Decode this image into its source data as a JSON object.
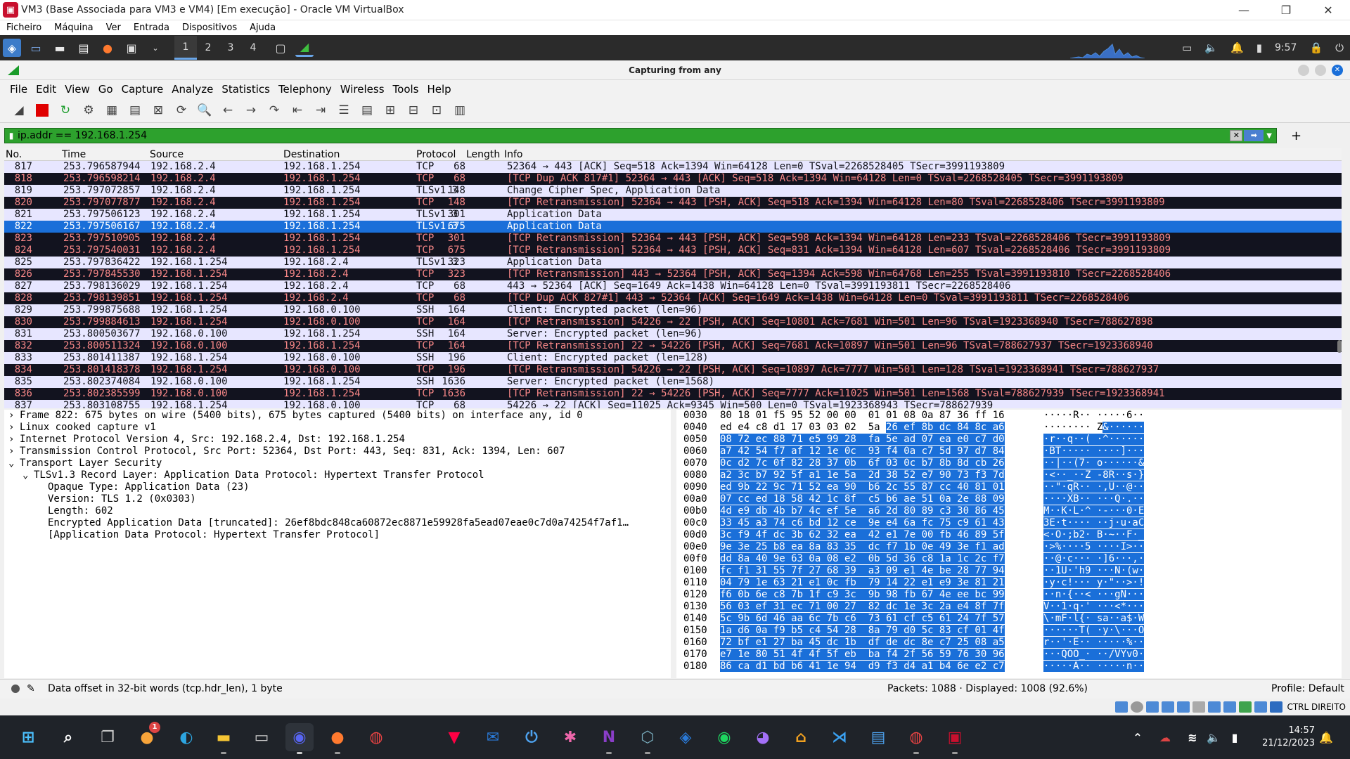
{
  "vbox": {
    "title": "VM3 (Base Associada para VM3 e VM4) [Em execução] - Oracle VM VirtualBox",
    "menu": [
      "Ficheiro",
      "Máquina",
      "Ver",
      "Entrada",
      "Dispositivos",
      "Ajuda"
    ],
    "host_key": "CTRL DIREITO"
  },
  "panel": {
    "workspaces": [
      "1",
      "2",
      "3",
      "4"
    ],
    "time": "9:57"
  },
  "wireshark": {
    "title": "Capturing from any",
    "menu": [
      "File",
      "Edit",
      "View",
      "Go",
      "Capture",
      "Analyze",
      "Statistics",
      "Telephony",
      "Wireless",
      "Tools",
      "Help"
    ],
    "filter": "ip.addr == 192.168.1.254",
    "columns": [
      "No.",
      "Time",
      "Source",
      "Destination",
      "Protocol",
      "Length",
      "Info"
    ],
    "packets": [
      {
        "no": "817",
        "time": "253.796587944",
        "src": "192.168.2.4",
        "dst": "192.168.1.254",
        "proto": "TCP",
        "len": "68",
        "info": "52364 → 443 [ACK] Seq=518 Ack=1394 Win=64128 Len=0 TSval=2268528405 TSecr=3991193809",
        "style": "tcp"
      },
      {
        "no": "818",
        "time": "253.796598214",
        "src": "192.168.2.4",
        "dst": "192.168.1.254",
        "proto": "TCP",
        "len": "68",
        "info": "[TCP Dup ACK 817#1] 52364 → 443 [ACK] Seq=518 Ack=1394 Win=64128 Len=0 TSval=2268528405 TSecr=3991193809",
        "style": "bad"
      },
      {
        "no": "819",
        "time": "253.797072857",
        "src": "192.168.2.4",
        "dst": "192.168.1.254",
        "proto": "TLSv1.3",
        "len": "148",
        "info": "Change Cipher Spec, Application Data",
        "style": "tls"
      },
      {
        "no": "820",
        "time": "253.797077877",
        "src": "192.168.2.4",
        "dst": "192.168.1.254",
        "proto": "TCP",
        "len": "148",
        "info": "[TCP Retransmission] 52364 → 443 [PSH, ACK] Seq=518 Ack=1394 Win=64128 Len=80 TSval=2268528406 TSecr=3991193809",
        "style": "bad"
      },
      {
        "no": "821",
        "time": "253.797506123",
        "src": "192.168.2.4",
        "dst": "192.168.1.254",
        "proto": "TLSv1.3",
        "len": "301",
        "info": "Application Data",
        "style": "tls"
      },
      {
        "no": "822",
        "time": "253.797506167",
        "src": "192.168.2.4",
        "dst": "192.168.1.254",
        "proto": "TLSv1.3",
        "len": "675",
        "info": "Application Data",
        "style": "sel"
      },
      {
        "no": "823",
        "time": "253.797510905",
        "src": "192.168.2.4",
        "dst": "192.168.1.254",
        "proto": "TCP",
        "len": "301",
        "info": "[TCP Retransmission] 52364 → 443 [PSH, ACK] Seq=598 Ack=1394 Win=64128 Len=233 TSval=2268528406 TSecr=3991193809",
        "style": "bad"
      },
      {
        "no": "824",
        "time": "253.797540031",
        "src": "192.168.2.4",
        "dst": "192.168.1.254",
        "proto": "TCP",
        "len": "675",
        "info": "[TCP Retransmission] 52364 → 443 [PSH, ACK] Seq=831 Ack=1394 Win=64128 Len=607 TSval=2268528406 TSecr=3991193809",
        "style": "bad"
      },
      {
        "no": "825",
        "time": "253.797836422",
        "src": "192.168.1.254",
        "dst": "192.168.2.4",
        "proto": "TLSv1.3",
        "len": "323",
        "info": "Application Data",
        "style": "tls"
      },
      {
        "no": "826",
        "time": "253.797845530",
        "src": "192.168.1.254",
        "dst": "192.168.2.4",
        "proto": "TCP",
        "len": "323",
        "info": "[TCP Retransmission] 443 → 52364 [PSH, ACK] Seq=1394 Ack=598 Win=64768 Len=255 TSval=3991193810 TSecr=2268528406",
        "style": "bad"
      },
      {
        "no": "827",
        "time": "253.798136029",
        "src": "192.168.1.254",
        "dst": "192.168.2.4",
        "proto": "TCP",
        "len": "68",
        "info": "443 → 52364 [ACK] Seq=1649 Ack=1438 Win=64128 Len=0 TSval=3991193811 TSecr=2268528406",
        "style": "tcp"
      },
      {
        "no": "828",
        "time": "253.798139851",
        "src": "192.168.1.254",
        "dst": "192.168.2.4",
        "proto": "TCP",
        "len": "68",
        "info": "[TCP Dup ACK 827#1] 443 → 52364 [ACK] Seq=1649 Ack=1438 Win=64128 Len=0 TSval=3991193811 TSecr=2268528406",
        "style": "bad"
      },
      {
        "no": "829",
        "time": "253.799875688",
        "src": "192.168.1.254",
        "dst": "192.168.0.100",
        "proto": "SSH",
        "len": "164",
        "info": "Client: Encrypted packet (len=96)",
        "style": "ssh"
      },
      {
        "no": "830",
        "time": "253.799884613",
        "src": "192.168.1.254",
        "dst": "192.168.0.100",
        "proto": "TCP",
        "len": "164",
        "info": "[TCP Retransmission] 54226 → 22 [PSH, ACK] Seq=10801 Ack=7681 Win=501 Len=96 TSval=1923368940 TSecr=788627898",
        "style": "bad"
      },
      {
        "no": "831",
        "time": "253.800503677",
        "src": "192.168.0.100",
        "dst": "192.168.1.254",
        "proto": "SSH",
        "len": "164",
        "info": "Server: Encrypted packet (len=96)",
        "style": "ssh"
      },
      {
        "no": "832",
        "time": "253.800511324",
        "src": "192.168.0.100",
        "dst": "192.168.1.254",
        "proto": "TCP",
        "len": "164",
        "info": "[TCP Retransmission] 22 → 54226 [PSH, ACK] Seq=7681 Ack=10897 Win=501 Len=96 TSval=788627937 TSecr=1923368940",
        "style": "bad"
      },
      {
        "no": "833",
        "time": "253.801411387",
        "src": "192.168.1.254",
        "dst": "192.168.0.100",
        "proto": "SSH",
        "len": "196",
        "info": "Client: Encrypted packet (len=128)",
        "style": "ssh"
      },
      {
        "no": "834",
        "time": "253.801418378",
        "src": "192.168.1.254",
        "dst": "192.168.0.100",
        "proto": "TCP",
        "len": "196",
        "info": "[TCP Retransmission] 54226 → 22 [PSH, ACK] Seq=10897 Ack=7777 Win=501 Len=128 TSval=1923368941 TSecr=788627937",
        "style": "bad"
      },
      {
        "no": "835",
        "time": "253.802374084",
        "src": "192.168.0.100",
        "dst": "192.168.1.254",
        "proto": "SSH",
        "len": "1636",
        "info": "Server: Encrypted packet (len=1568)",
        "style": "ssh"
      },
      {
        "no": "836",
        "time": "253.802385599",
        "src": "192.168.0.100",
        "dst": "192.168.1.254",
        "proto": "TCP",
        "len": "1636",
        "info": "[TCP Retransmission] 22 → 54226 [PSH, ACK] Seq=7777 Ack=11025 Win=501 Len=1568 TSval=788627939 TSecr=1923368941",
        "style": "bad"
      },
      {
        "no": "837",
        "time": "253.803108755",
        "src": "192.168.1.254",
        "dst": "192.168.0.100",
        "proto": "TCP",
        "len": "68",
        "info": "54226 → 22 [ACK] Seq=11025 Ack=9345 Win=500 Len=0 TSval=1923368943 TSecr=788627939",
        "style": "tcp"
      }
    ],
    "details": [
      {
        "arrow": "›",
        "text": "Frame 822: 675 bytes on wire (5400 bits), 675 bytes captured (5400 bits) on interface any, id 0",
        "level": 0
      },
      {
        "arrow": "›",
        "text": "Linux cooked capture v1",
        "level": 0
      },
      {
        "arrow": "›",
        "text": "Internet Protocol Version 4, Src: 192.168.2.4, Dst: 192.168.1.254",
        "level": 0
      },
      {
        "arrow": "›",
        "text": "Transmission Control Protocol, Src Port: 52364, Dst Port: 443, Seq: 831, Ack: 1394, Len: 607",
        "level": 0
      },
      {
        "arrow": "⌄",
        "text": "Transport Layer Security",
        "level": 0
      },
      {
        "arrow": "⌄",
        "text": "TLSv1.3 Record Layer: Application Data Protocol: Hypertext Transfer Protocol",
        "level": 1
      },
      {
        "arrow": "",
        "text": "Opaque Type: Application Data (23)",
        "level": 2
      },
      {
        "arrow": "",
        "text": "Version: TLS 1.2 (0x0303)",
        "level": 2
      },
      {
        "arrow": "",
        "text": "Length: 602",
        "level": 2
      },
      {
        "arrow": "",
        "text": "Encrypted Application Data [truncated]: 26ef8bdc848ca60872ec8871e59928fa5ead07eae0c7d0a74254f7af1…",
        "level": 2
      },
      {
        "arrow": "",
        "text": "[Application Data Protocol: Hypertext Transfer Protocol]",
        "level": 2
      }
    ],
    "hex": [
      {
        "off": "0030",
        "pre": "80 18 01 f5 95 52 00 00  01 01 08 0a 87 36 ff 16",
        "hl": "",
        "apre": "·····R·· ·····6··",
        "ahl": ""
      },
      {
        "off": "0040",
        "pre": "ed e4 c8 d1 17 03 03 02  5a ",
        "hl": "26 ef 8b dc 84 8c a6",
        "apre": "········ Z",
        "ahl": "&······"
      },
      {
        "off": "0050",
        "pre": "",
        "hl": "08 72 ec 88 71 e5 99 28  fa 5e ad 07 ea e0 c7 d0",
        "apre": "",
        "ahl": "·r··q··( ·^······"
      },
      {
        "off": "0060",
        "pre": "",
        "hl": "a7 42 54 f7 af 12 1e 0c  93 f4 0a c7 5d 97 d7 84",
        "apre": "",
        "ahl": "·BT····· ····]···"
      },
      {
        "off": "0070",
        "pre": "",
        "hl": "0c d2 7c 0f 82 28 37 0b  6f 03 0c b7 8b 8d cb 26",
        "apre": "",
        "ahl": "··|··(7· o······&"
      },
      {
        "off": "0080",
        "pre": "",
        "hl": "a2 3c b7 92 5f a1 1e 5a  2d 38 52 e7 90 73 f3 7d",
        "apre": "",
        "ahl": "·<··_··Z -8R··s·}"
      },
      {
        "off": "0090",
        "pre": "",
        "hl": "ed 9b 22 9c 71 52 ea 90  b6 2c 55 87 cc 40 81 01",
        "apre": "",
        "ahl": "··\"·qR·· ·,U··@··"
      },
      {
        "off": "00a0",
        "pre": "",
        "hl": "07 cc ed 18 58 42 1c 8f  c5 b6 ae 51 0a 2e 88 09",
        "apre": "",
        "ahl": "····XB·· ···Q·.··"
      },
      {
        "off": "00b0",
        "pre": "",
        "hl": "4d e9 db 4b b7 4c ef 5e  a6 2d 80 89 c3 30 86 45",
        "apre": "",
        "ahl": "M··K·L·^ ·-···0·E"
      },
      {
        "off": "00c0",
        "pre": "",
        "hl": "33 45 a3 74 c6 bd 12 ce  9e e4 6a fc 75 c9 61 43",
        "apre": "",
        "ahl": "3E·t···· ··j·u·aC"
      },
      {
        "off": "00d0",
        "pre": "",
        "hl": "3c f9 4f dc 3b 62 32 ea  42 e1 7e 00 fb 46 89 5f",
        "apre": "",
        "ahl": "<·O·;b2· B·~··F·_"
      },
      {
        "off": "00e0",
        "pre": "",
        "hl": "9e 3e 25 b8 ea 8a 83 35  dc f7 1b 0e 49 3e f1 ad",
        "apre": "",
        "ahl": "·>%····5 ····I>··"
      },
      {
        "off": "00f0",
        "pre": "",
        "hl": "dd 8a 40 9e 63 0a 08 e2  0b 5d 36 c8 1a 1c 2c f7",
        "apre": "",
        "ahl": "··@·c··· ·]6···,·"
      },
      {
        "off": "0100",
        "pre": "",
        "hl": "fc f1 31 55 7f 27 68 39  a3 09 e1 4e be 28 77 94",
        "apre": "",
        "ahl": "··1U·'h9 ···N·(w·"
      },
      {
        "off": "0110",
        "pre": "",
        "hl": "04 79 1e 63 21 e1 0c fb  79 14 22 e1 e9 3e 81 21",
        "apre": "",
        "ahl": "·y·c!··· y·\"··>·!"
      },
      {
        "off": "0120",
        "pre": "",
        "hl": "f6 0b 6e c8 7b 1f c9 3c  9b 98 fb 67 4e ee bc 99",
        "apre": "",
        "ahl": "··n·{··< ···gN···"
      },
      {
        "off": "0130",
        "pre": "",
        "hl": "56 03 ef 31 ec 71 00 27  82 dc 1e 3c 2a e4 8f 7f",
        "apre": "",
        "ahl": "V··1·q·' ···<*···"
      },
      {
        "off": "0140",
        "pre": "",
        "hl": "5c 9b 6d 46 aa 6c 7b c6  73 61 cf c5 61 24 7f 57",
        "apre": "",
        "ahl": "\\·mF·l{· sa··a$·W"
      },
      {
        "off": "0150",
        "pre": "",
        "hl": "1a d6 0a f9 b5 c4 54 28  8a 79 d0 5c 83 cf 01 4f",
        "apre": "",
        "ahl": "······T( ·y·\\···O"
      },
      {
        "off": "0160",
        "pre": "",
        "hl": "72 bf e1 27 ba 45 dc 1b  df de dc 8e c7 25 08 a5",
        "apre": "",
        "ahl": "r··'·E·· ·····%··"
      },
      {
        "off": "0170",
        "pre": "",
        "hl": "e7 1e 80 51 4f 4f 5f eb  ba f4 2f 56 59 76 30 96",
        "apre": "",
        "ahl": "···QOO_· ··/VYv0·"
      },
      {
        "off": "0180",
        "pre": "",
        "hl": "86 ca d1 bd b6 41 1e 94  d9 f3 d4 a1 b4 6e e2 c7",
        "apre": "",
        "ahl": "·····A·· ·····n··"
      }
    ],
    "status": {
      "field": "Data offset in 32-bit words (tcp.hdr_len), 1 byte",
      "packets": "Packets: 1088 · Displayed: 1008 (92.6%)",
      "profile": "Profile: Default"
    }
  },
  "taskbar": {
    "time": "14:57",
    "date": "21/12/2023",
    "badge": "1"
  }
}
